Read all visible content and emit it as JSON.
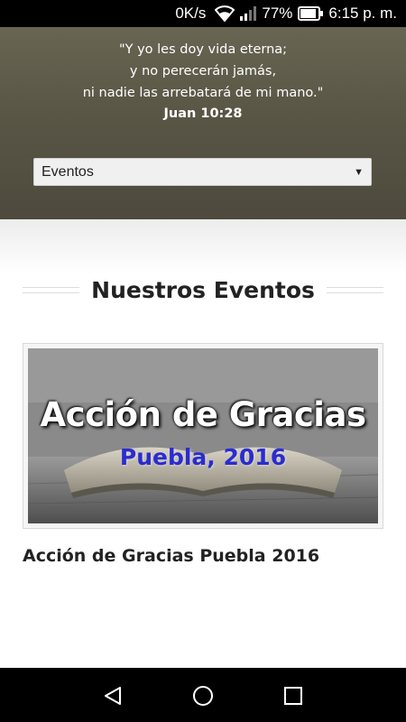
{
  "status_bar": {
    "net_speed": "0K/s",
    "battery": "77%",
    "time": "6:15 p. m."
  },
  "hero": {
    "verse_lines": [
      "\"Y yo les doy vida eterna;",
      "y no perecerán jamás,",
      "ni nadie las arrebatará de mi mano.\""
    ],
    "reference": "Juan 10:28",
    "menu_select": {
      "selected": "Eventos",
      "arrow": "▼"
    }
  },
  "main": {
    "section_title": "Nuestros Eventos",
    "events": [
      {
        "image_title": "Acción de Gracias",
        "image_subtitle": "Puebla, 2016",
        "name": "Acción de Gracias Puebla 2016"
      }
    ]
  },
  "nav": {
    "icons": [
      "back-icon",
      "home-icon",
      "recents-icon"
    ]
  },
  "colors": {
    "hero_bg": "#5a5646",
    "subtitle_blue": "#2a2cd0",
    "text_dark": "#222222"
  }
}
